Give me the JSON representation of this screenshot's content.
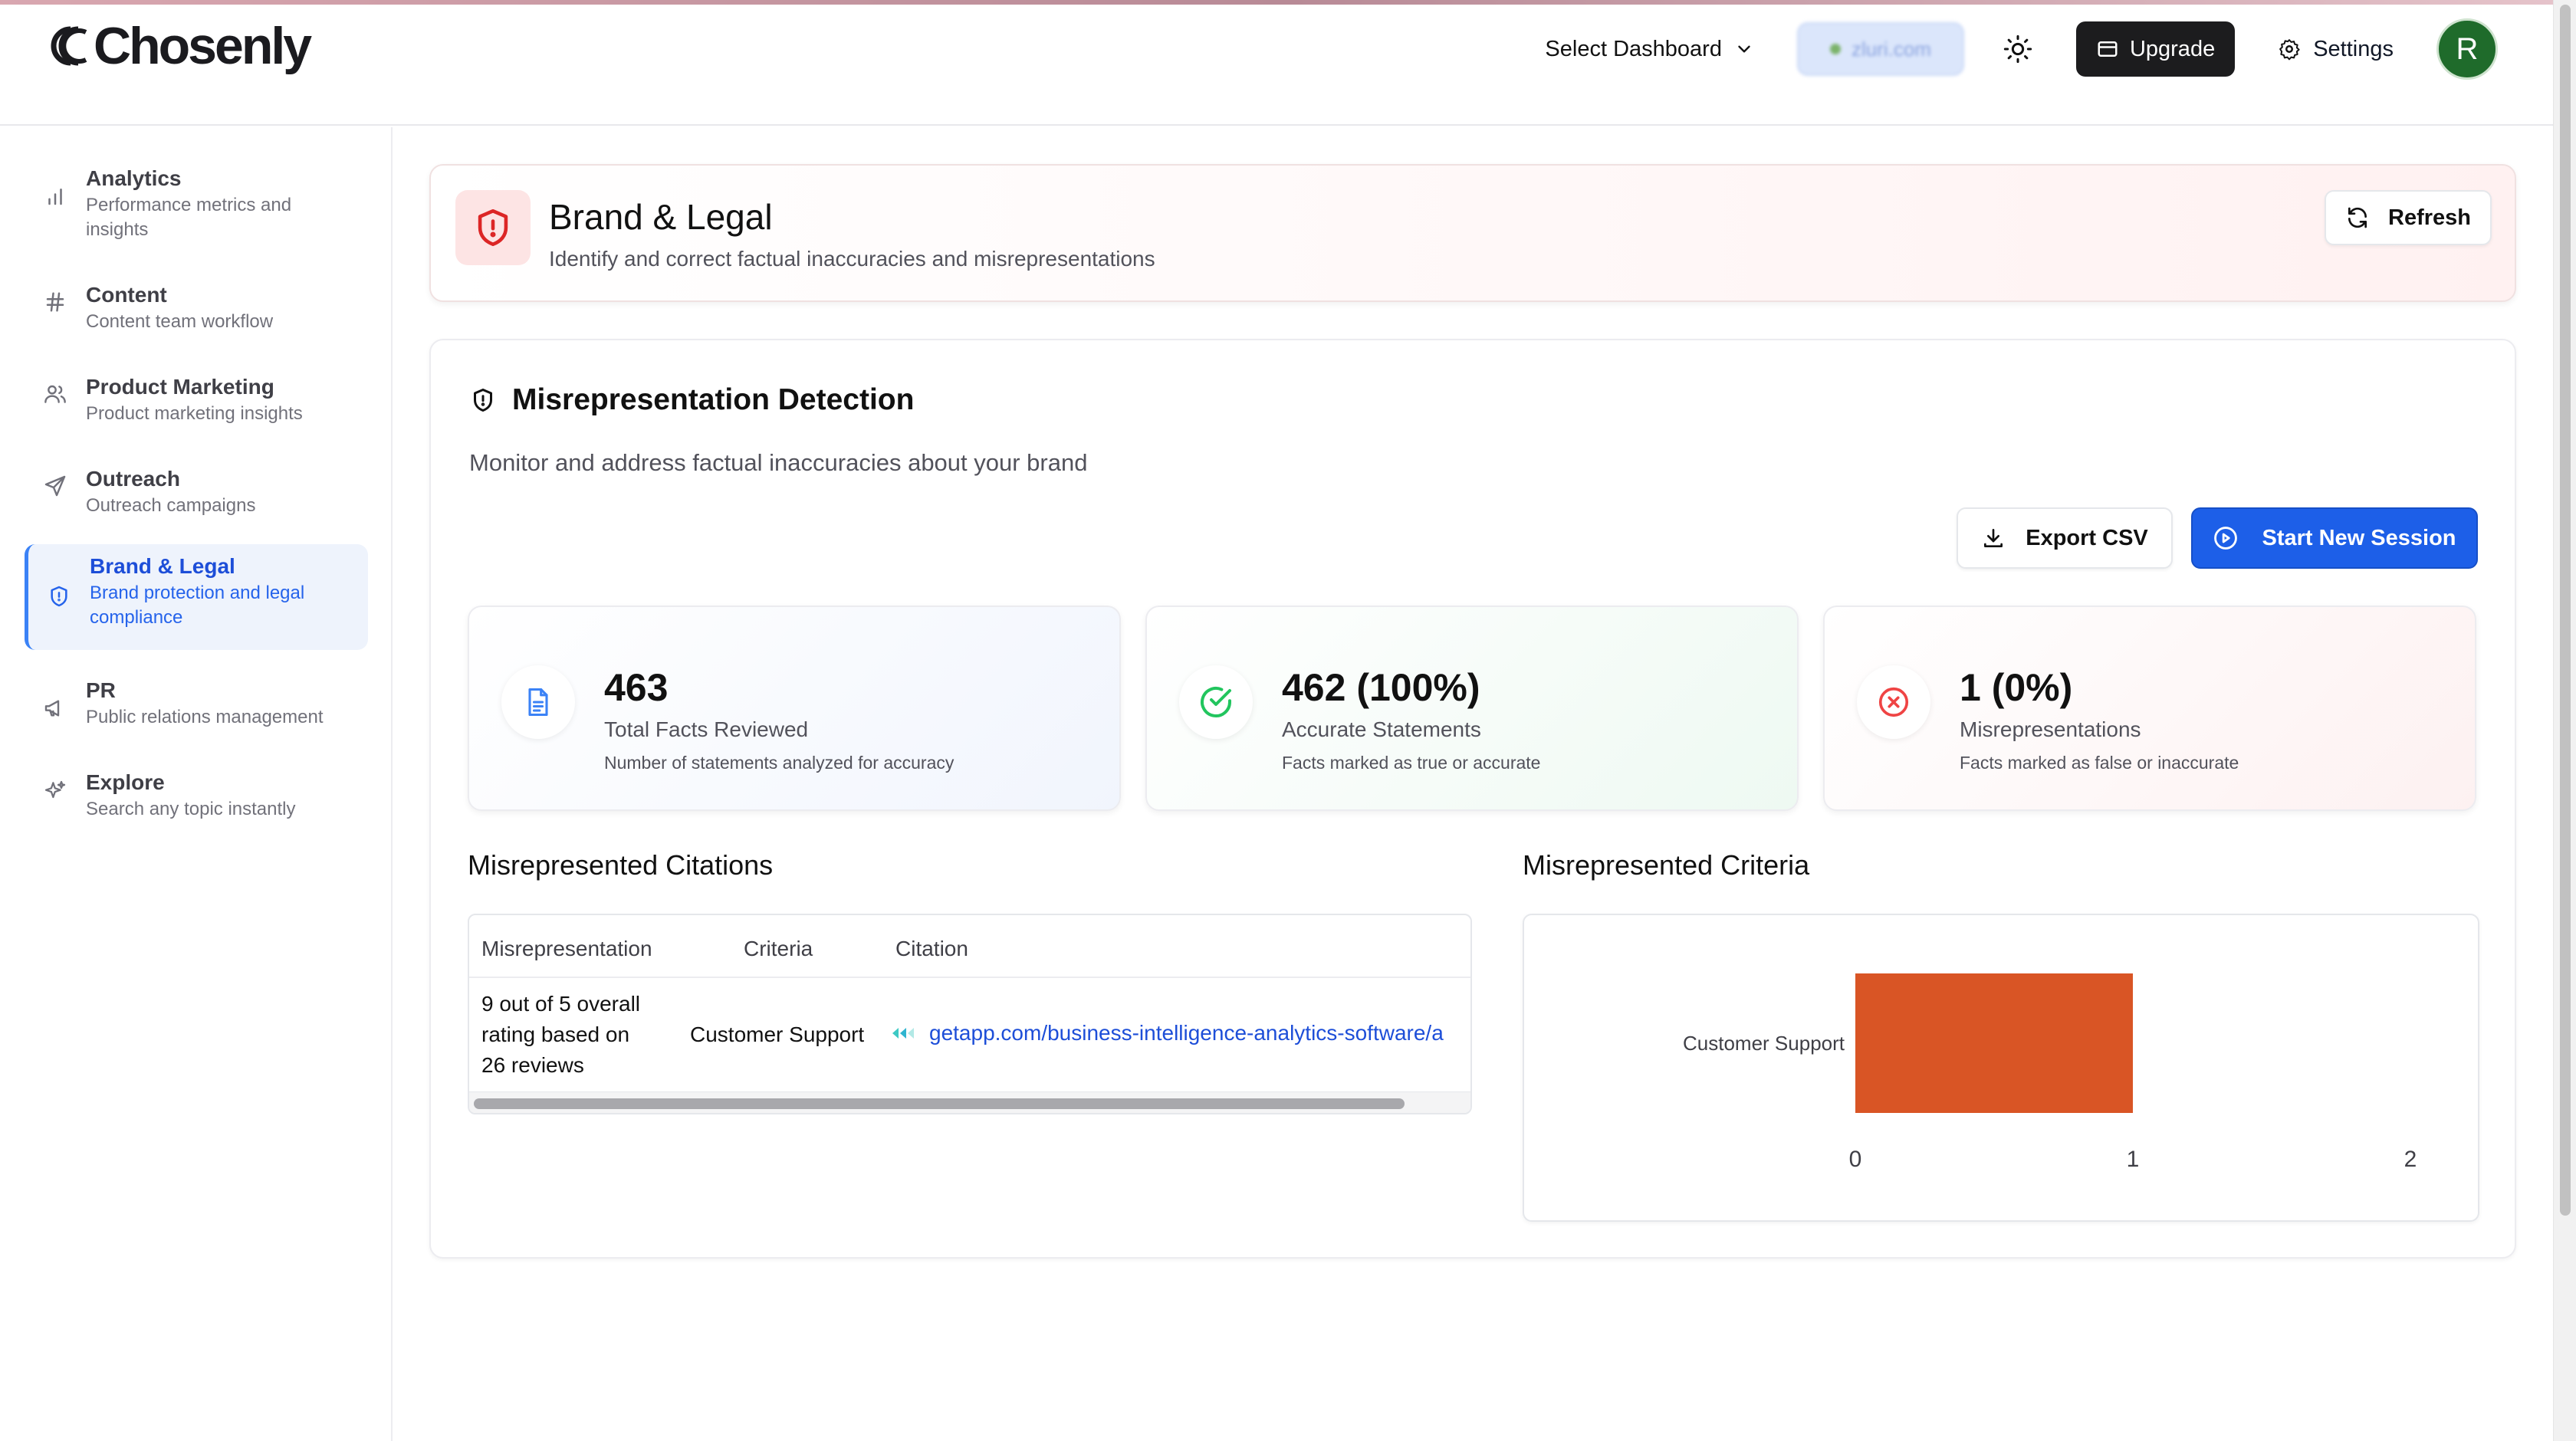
{
  "app": {
    "logo_text": "Chosenly"
  },
  "header": {
    "select_dashboard": "Select Dashboard",
    "domain": "zluri.com",
    "upgrade": "Upgrade",
    "settings": "Settings",
    "avatar_initial": "R"
  },
  "sidebar": {
    "items": [
      {
        "title": "Analytics",
        "subtitle": "Performance metrics and insights",
        "icon": "bar-chart-icon"
      },
      {
        "title": "Content",
        "subtitle": "Content team workflow",
        "icon": "hash-icon"
      },
      {
        "title": "Product Marketing",
        "subtitle": "Product marketing insights",
        "icon": "users-icon"
      },
      {
        "title": "Outreach",
        "subtitle": "Outreach campaigns",
        "icon": "send-icon"
      },
      {
        "title": "Brand & Legal",
        "subtitle": "Brand protection and legal compliance",
        "icon": "shield-icon",
        "active": true
      },
      {
        "title": "PR",
        "subtitle": "Public relations management",
        "icon": "megaphone-icon"
      },
      {
        "title": "Explore",
        "subtitle": "Search any topic instantly",
        "icon": "sparkles-icon"
      }
    ]
  },
  "page": {
    "title": "Brand & Legal",
    "subtitle": "Identify and correct factual inaccuracies and misrepresentations",
    "refresh": "Refresh"
  },
  "detection": {
    "title": "Misrepresentation Detection",
    "subtitle": "Monitor and address factual inaccuracies about your brand",
    "export_csv": "Export CSV",
    "start_session": "Start New Session"
  },
  "stats": [
    {
      "value": "463",
      "label": "Total Facts Reviewed",
      "desc": "Number of statements analyzed for accuracy",
      "icon": "document-icon",
      "color": "#3b82f6"
    },
    {
      "value": "462 (100%)",
      "label": "Accurate Statements",
      "desc": "Facts marked as true or accurate",
      "icon": "check-circle-icon",
      "color": "#22c55e"
    },
    {
      "value": "1 (0%)",
      "label": "Misrepresentations",
      "desc": "Facts marked as false or inaccurate",
      "icon": "x-circle-icon",
      "color": "#ef4444"
    }
  ],
  "citations": {
    "title": "Misrepresented Citations",
    "columns": [
      "Misrepresentation",
      "Criteria",
      "Citation"
    ],
    "rows": [
      {
        "misrepresentation_lines": [
          "9 out of 5 overall",
          "rating based on",
          "26 reviews"
        ],
        "criteria": "Customer Support",
        "citation": "getapp.com/business-intelligence-analytics-software/a"
      }
    ]
  },
  "criteria": {
    "title": "Misrepresented Criteria"
  },
  "chart_data": {
    "type": "bar",
    "orientation": "horizontal",
    "categories": [
      "Customer Support"
    ],
    "values": [
      1
    ],
    "xlim": [
      0,
      2
    ],
    "xticks": [
      "0",
      "1",
      "2"
    ],
    "color": "#d95525",
    "title": "",
    "xlabel": "",
    "ylabel": ""
  }
}
